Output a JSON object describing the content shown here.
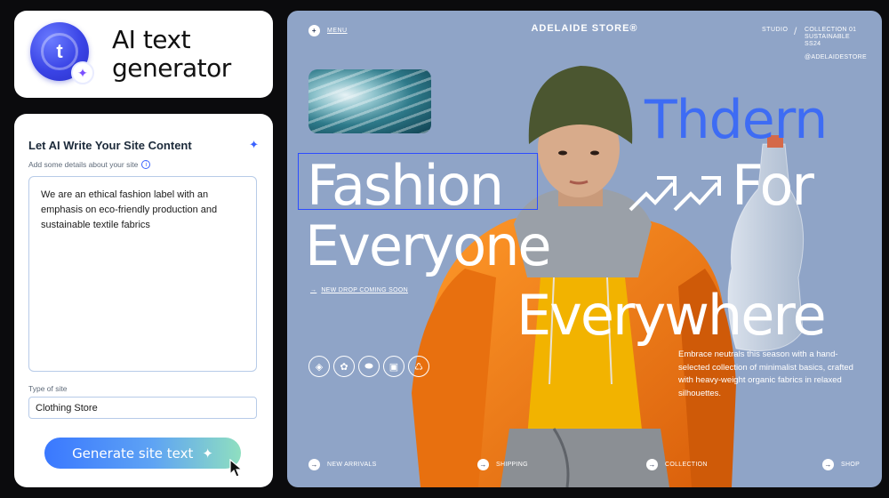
{
  "brand": {
    "title": "AI text generator",
    "logo_icon": "t-letter-icon",
    "badge_icon": "sparkle-icon"
  },
  "form": {
    "title": "Let AI Write Your Site Content",
    "subtitle": "Add some details about your site",
    "description": "We are an ethical fashion label with an emphasis on eco-friendly production and sustainable textile fabrics",
    "type_label": "Type of site",
    "type_value": "Clothing Store",
    "generate_label": "Generate site text"
  },
  "hero": {
    "menu_label": "MENU",
    "store_name": "ADELAIDE STORE®",
    "studio_label": "STUDIO",
    "collection_line1": "COLLECTION 01",
    "collection_line2": "SUSTAINABLE",
    "collection_line3": "SS24",
    "handle": "@ADELAIDESTORE",
    "word_thdern": "Thdern",
    "word_fashion": "Fashion",
    "word_for": "For",
    "word_everyone": "Everyone",
    "word_everywhere": "Everywhere",
    "new_drop": "NEW DROP COMING SOON",
    "blurb": "Embrace neutrals this season with a hand-selected collection of minimalist basics, crafted with heavy-weight organic fabrics in relaxed silhouettes.",
    "bottom_nav": [
      "NEW ARRIVALS",
      "SHIPPING",
      "COLLECTION",
      "SHOP"
    ]
  },
  "colors": {
    "accent": "#3a62ff",
    "hero_bg": "#8fa4c7",
    "jacket": "#f07a16",
    "thdern": "#3e6cf4"
  }
}
